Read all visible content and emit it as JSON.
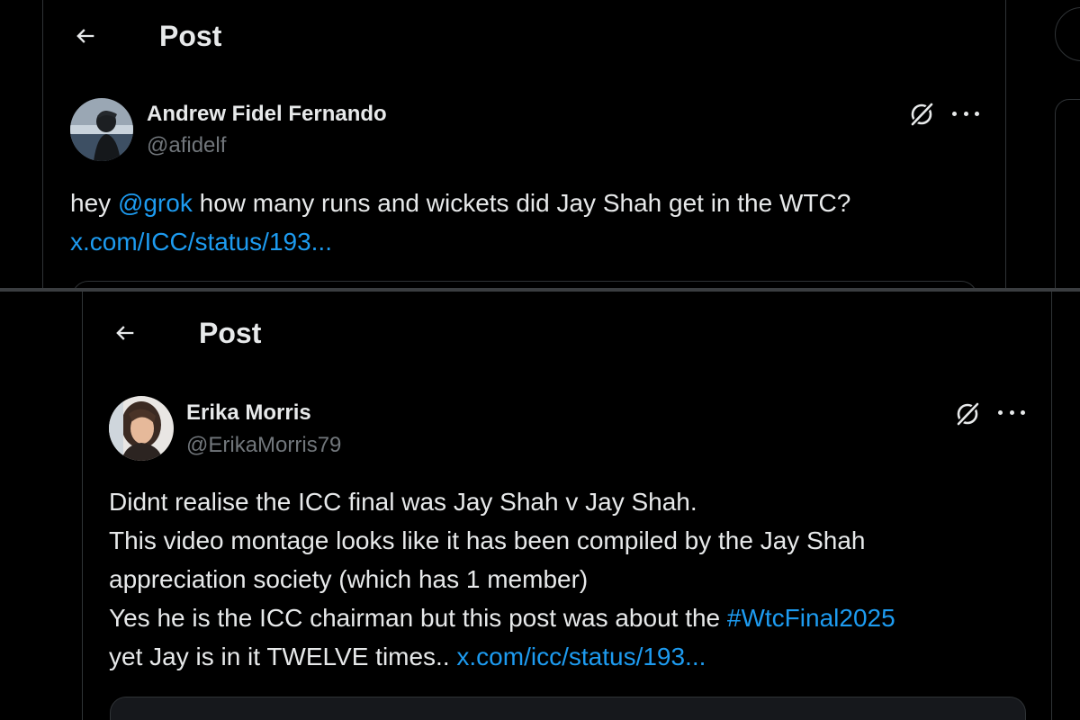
{
  "top": {
    "header": {
      "title": "Post"
    },
    "post": {
      "display_name": "Andrew Fidel Fernando",
      "handle": "@afidelf",
      "text_part1": "hey ",
      "mention": "@grok",
      "text_part2": " how many runs and wickets did Jay Shah get in the WTC?",
      "link": "x.com/ICC/status/193..."
    }
  },
  "bottom": {
    "header": {
      "title": "Post"
    },
    "post": {
      "display_name": "Erika Morris",
      "handle": "@ErikaMorris79",
      "line1": "Didnt realise the ICC final was Jay Shah v Jay Shah.",
      "line2": "This video montage looks like it has been compiled by the Jay Shah",
      "line3": "appreciation society (which has 1 member)",
      "line4_text": "Yes he is the ICC chairman but this post was about the ",
      "line4_hashtag": "#WtcFinal2025",
      "line5_text": "yet Jay is in it TWELVE times.. ",
      "line5_link": "x.com/icc/status/193..."
    }
  },
  "colors": {
    "background": "#000000",
    "text": "#e7e9ea",
    "secondary": "#71767b",
    "link": "#1d9bf0",
    "border": "#2f3336"
  },
  "icons": [
    "back-arrow-icon",
    "grok-icon",
    "more-icon"
  ]
}
